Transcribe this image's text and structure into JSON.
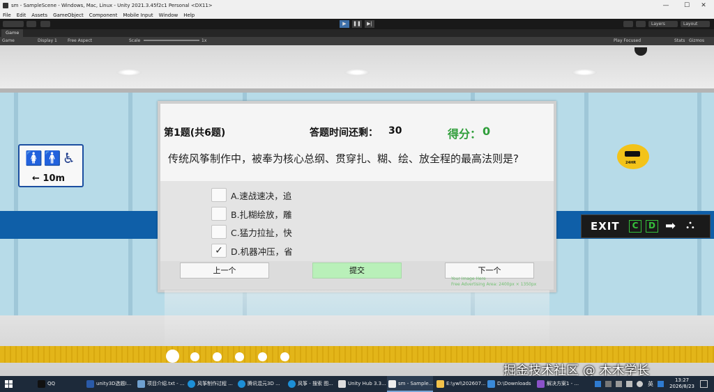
{
  "window": {
    "title": "sm - SampleScene - Windows, Mac, Linux - Unity 2021.3.45f2c1 Personal <DX11>",
    "min": "—",
    "max": "☐",
    "close": "✕"
  },
  "menu": [
    "File",
    "Edit",
    "Assets",
    "GameObject",
    "Component",
    "Mobile Input",
    "Window",
    "Help"
  ],
  "toolbar": {
    "layers": "Layers",
    "layout": "Layout"
  },
  "game_tab": {
    "tab_label": "Game",
    "display_mode": "Game",
    "display": "Display 1",
    "aspect": "Free Aspect",
    "scale_label": "Scale",
    "scale_value": "1x",
    "play_focused": "Play Focused",
    "stats": "Stats",
    "gizmos": "Gizmos"
  },
  "scene": {
    "restroom_distance": "← 10m",
    "cctv_label": "24HR",
    "exit_text": "EXIT",
    "exit_c": "C",
    "exit_d": "D"
  },
  "quiz": {
    "index": "第1题(共6题)",
    "timer_label": "答题时间还剩：",
    "timer_value": "30",
    "score_label": "得分：",
    "score_value": "0",
    "question": "传统风筝制作中，被奉为核心总纲、贯穿扎、糊、绘、放全程的最高法则是?",
    "options": [
      {
        "text": "A.速战速决，追",
        "checked": false
      },
      {
        "text": "B.扎糊绘放，雕",
        "checked": false
      },
      {
        "text": "C.猛力拉扯，快",
        "checked": false
      },
      {
        "text": "D.机器冲压，省",
        "checked": true
      }
    ],
    "check_mark": "✓",
    "prev": "上一个",
    "submit": "提交",
    "next": "下一个",
    "ad_line1": "Your Image Here",
    "ad_line2": "Free Advertising Area: 2400px × 1350px"
  },
  "watermark": "掘金技术社区 @ 木木学长",
  "taskbar": {
    "items": [
      "QQ",
      "unity3D选题I...",
      "项目介绍.txt - ...",
      "风筝制作过程 ...",
      "腾讯混元3D ...",
      "风筝 - 搜索 图...",
      "Unity Hub 3.3...",
      "sm - Sample...",
      "E:\\ywl\\202607...",
      "D:\\Downloads",
      "解决方案1 - ..."
    ],
    "ime": "英",
    "time": "13:27",
    "date": "2026/8/23"
  }
}
